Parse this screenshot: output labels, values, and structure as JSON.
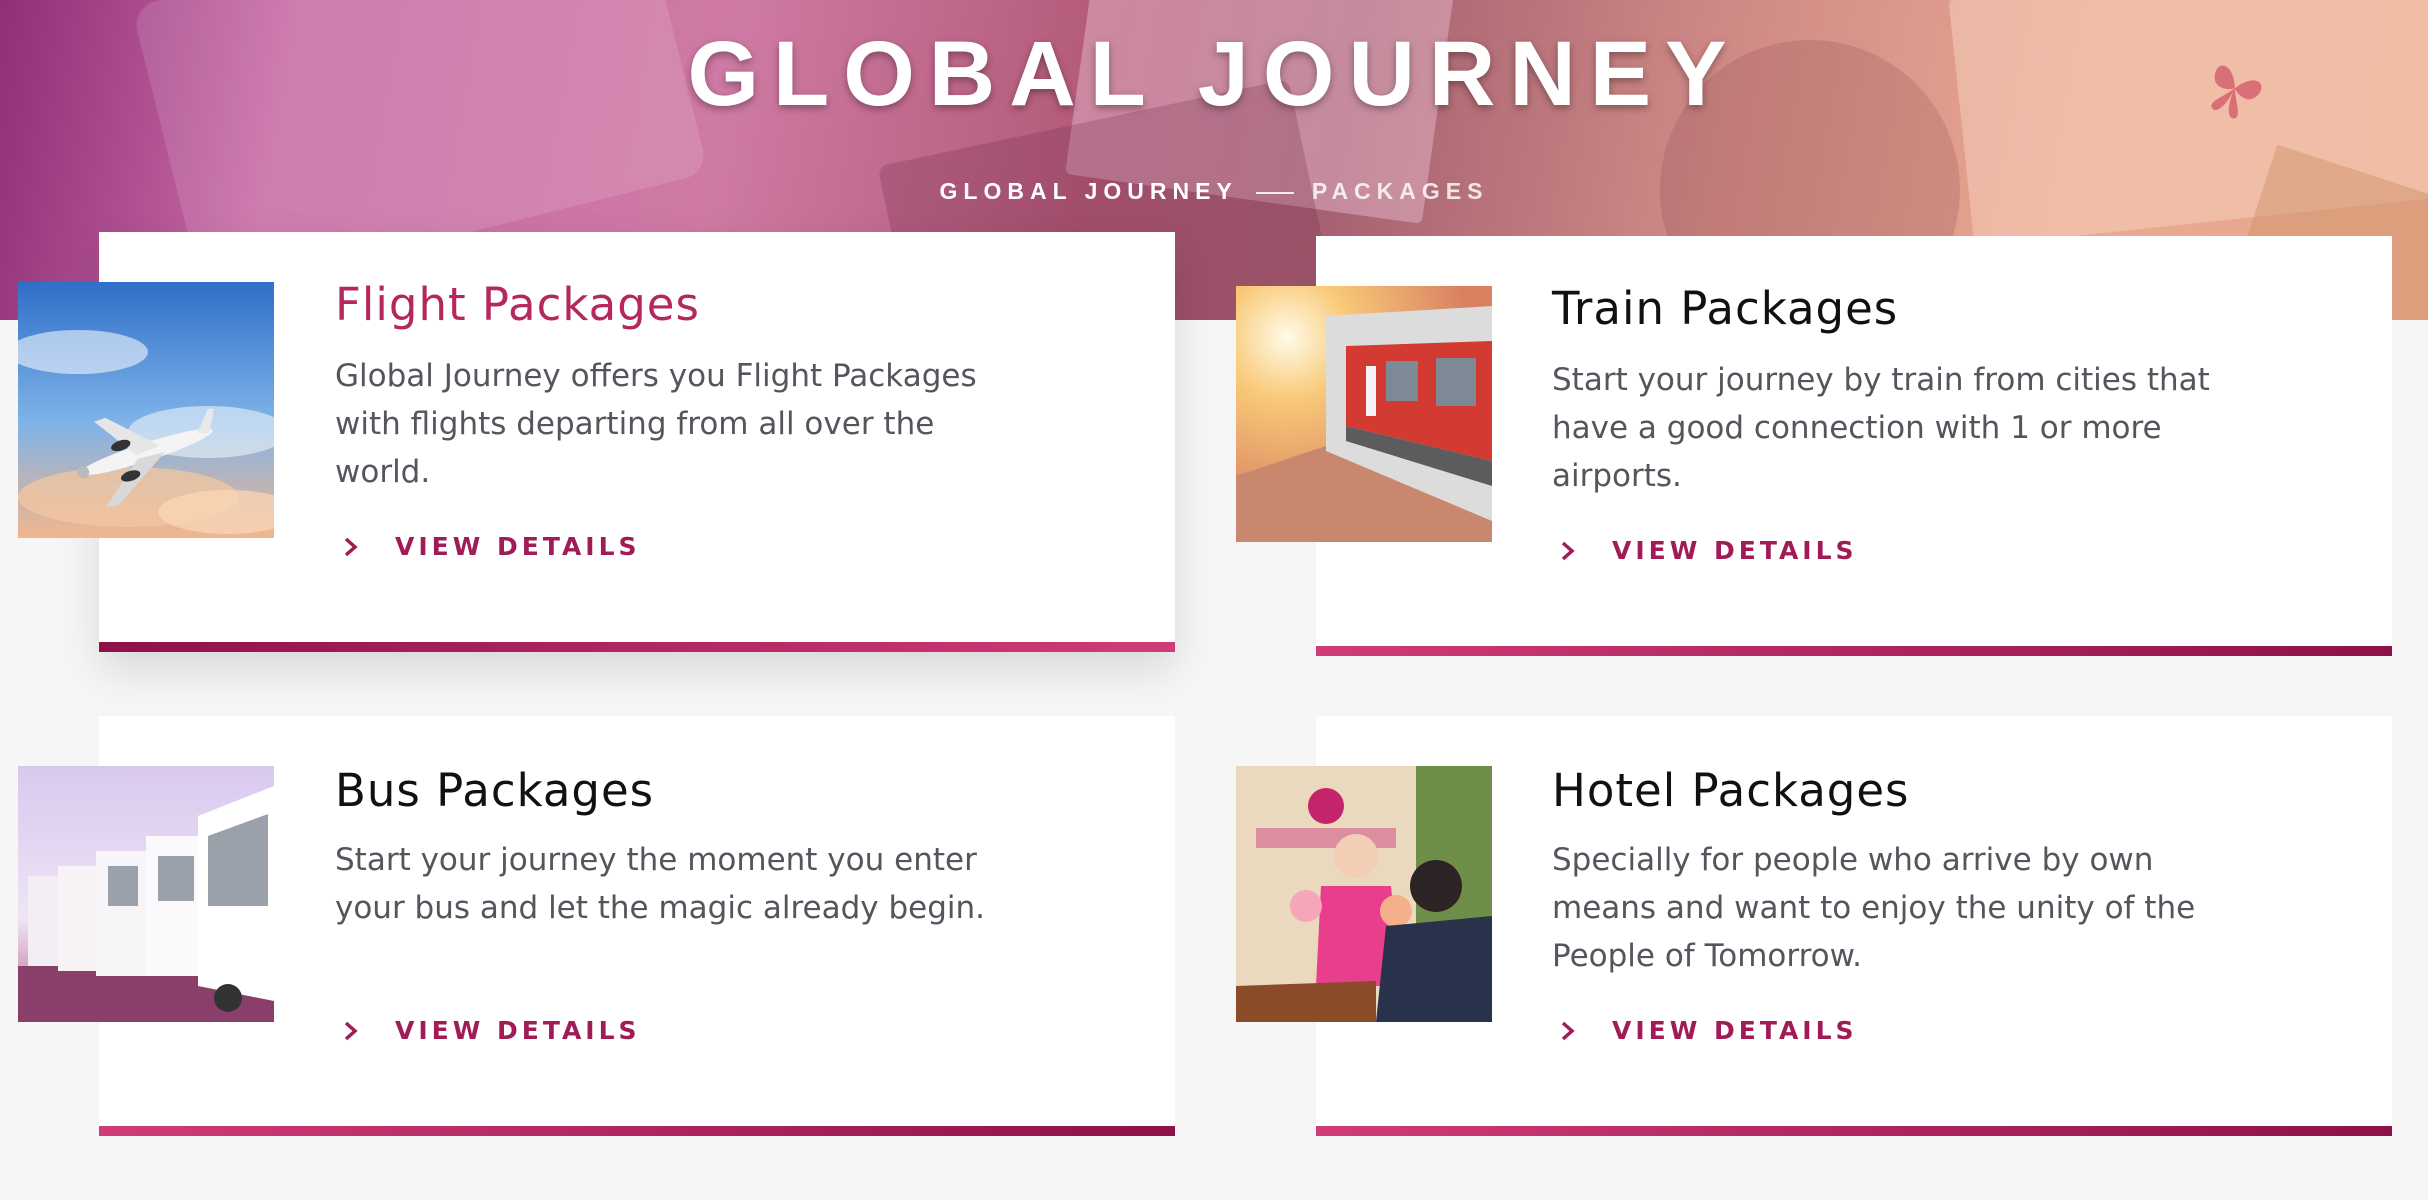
{
  "hero": {
    "title": "GLOBAL JOURNEY",
    "breadcrumb": {
      "home": "GLOBAL JOURNEY",
      "current": "PACKAGES"
    }
  },
  "cards": [
    {
      "title": "Flight Packages",
      "description": "Global Journey offers you Flight Packages with flights departing from all over the world.",
      "link": "VIEW DETAILS",
      "image": "airplane-in-sky-photo"
    },
    {
      "title": "Train Packages",
      "description": "Start your journey by train from cities that have a good connection with 1 or more airports.",
      "link": "VIEW DETAILS",
      "image": "red-train-at-platform-photo"
    },
    {
      "title": "Bus Packages",
      "description": "Start your journey the moment you enter your bus and let the magic already begin.",
      "link": "VIEW DETAILS",
      "image": "row-of-coaches-photo"
    },
    {
      "title": "Hotel Packages",
      "description": "Specially for people who arrive by own means and want to enjoy the unity of the People of Tomorrow.",
      "link": "VIEW DETAILS",
      "image": "hotel-welcome-desk-photo"
    }
  ],
  "colors": {
    "accent": "#a11c56",
    "accent_light": "#d13c78",
    "title_active": "#b6275e",
    "text": "#55555d",
    "background": "#f6f6f6"
  }
}
